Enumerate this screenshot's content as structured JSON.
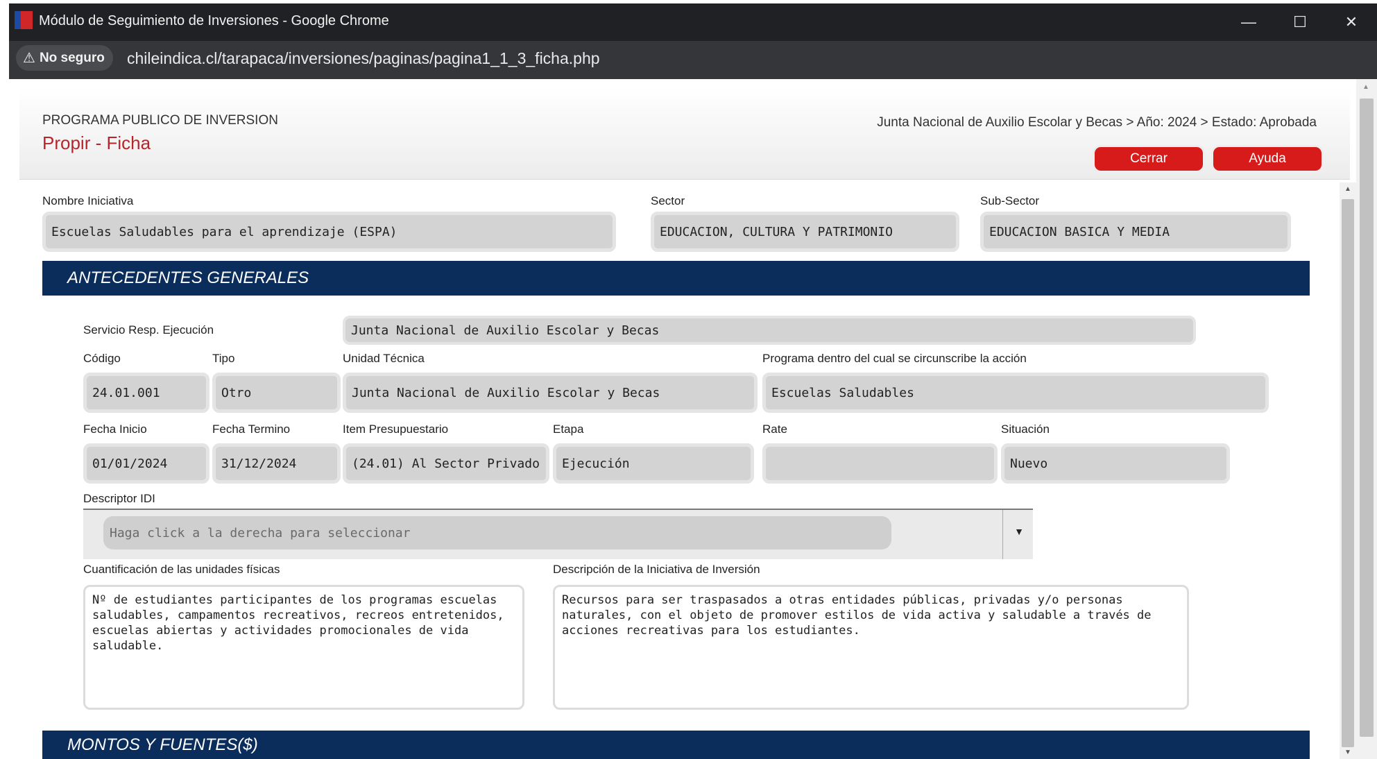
{
  "window": {
    "title": "Módulo de Seguimiento de Inversiones - Google Chrome",
    "controls": {
      "minimize": "—",
      "maximize": "☐",
      "close": "✕"
    }
  },
  "address_bar": {
    "security_label": "No seguro",
    "warning_glyph": "⚠",
    "url": "chileindica.cl/tarapaca/inversiones/paginas/pagina1_1_3_ficha.php"
  },
  "header": {
    "kicker": "PROGRAMA PUBLICO DE INVERSION",
    "title": "Propir - Ficha",
    "breadcrumb": "Junta Nacional de Auxilio Escolar y Becas > Año: 2024 > Estado: Aprobada",
    "close_button": "Cerrar",
    "help_button": "Ayuda"
  },
  "top_fields": {
    "nombre_label": "Nombre Iniciativa",
    "nombre_value": "Escuelas Saludables para el aprendizaje (ESPA)",
    "sector_label": "Sector",
    "sector_value": "EDUCACION, CULTURA Y PATRIMONIO",
    "subsector_label": "Sub-Sector",
    "subsector_value": "EDUCACION BASICA Y MEDIA"
  },
  "antecedentes": {
    "section_title": "ANTECEDENTES GENERALES",
    "servicio_label": "Servicio Resp. Ejecución",
    "servicio_value": "Junta Nacional de Auxilio Escolar y Becas",
    "codigo_label": "Código",
    "codigo_value": "24.01.001",
    "tipo_label": "Tipo",
    "tipo_value": "Otro",
    "unidad_label": "Unidad Técnica",
    "unidad_value": "Junta Nacional de Auxilio Escolar y Becas",
    "programa_label": "Programa dentro del cual se circunscribe la acción",
    "programa_value": "Escuelas Saludables",
    "fecha_inicio_label": "Fecha Inicio",
    "fecha_inicio_value": "01/01/2024",
    "fecha_termino_label": "Fecha Termino",
    "fecha_termino_value": "31/12/2024",
    "item_label": "Item Presupuestario",
    "item_value": "(24.01) Al Sector Privado",
    "etapa_label": "Etapa",
    "etapa_value": "Ejecución",
    "rate_label": "Rate",
    "rate_value": "",
    "situacion_label": "Situación",
    "situacion_value": "Nuevo",
    "descriptor_label": "Descriptor IDI",
    "descriptor_placeholder": "Haga click a la derecha para seleccionar",
    "cuantificacion_label": "Cuantificación de las unidades físicas",
    "cuantificacion_value": "Nº de estudiantes participantes de los programas escuelas saludables, campamentos recreativos, recreos entretenidos, escuelas abiertas y actividades promocionales de vida saludable.",
    "descripcion_label": "Descripción de la Iniciativa de Inversión",
    "descripcion_value": "Recursos para ser traspasados a otras entidades públicas, privadas y/o personas naturales, con el objeto  de promover estilos de vida activa y saludable a través de acciones recreativas para los estudiantes."
  },
  "montos": {
    "section_title": "MONTOS Y FUENTES($)"
  }
}
